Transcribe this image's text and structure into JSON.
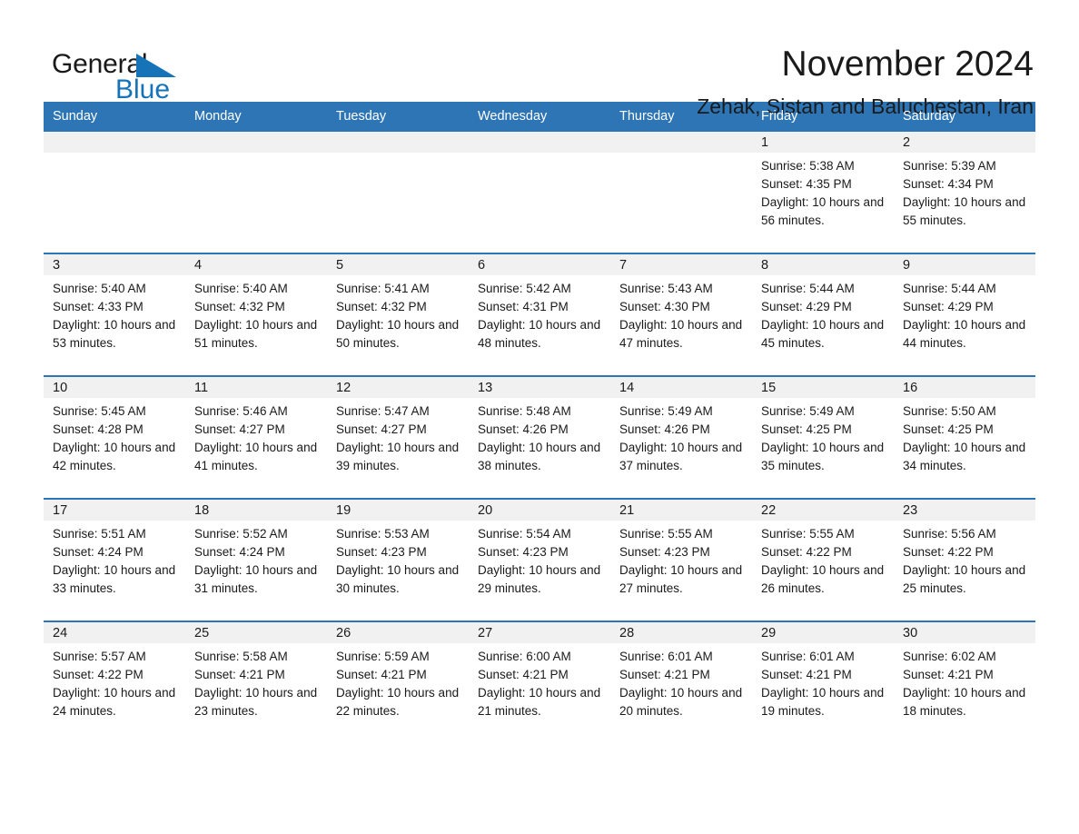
{
  "logo": {
    "word_one": "General",
    "word_two": "Blue",
    "triangle_icon": "triangle-icon",
    "brand_color": "#1773b8"
  },
  "header": {
    "month_title": "November 2024",
    "location": "Zehak, Sistan and Baluchestan, Iran"
  },
  "theme": {
    "header_blue": "#2e75b6",
    "daynum_band": "#f1f1f1",
    "text": "#1a1a1a"
  },
  "calendar": {
    "weekday_headers": [
      "Sunday",
      "Monday",
      "Tuesday",
      "Wednesday",
      "Thursday",
      "Friday",
      "Saturday"
    ],
    "weeks": [
      [
        {
          "day": "",
          "sunrise": "",
          "sunset": "",
          "daylight": "",
          "empty": true
        },
        {
          "day": "",
          "sunrise": "",
          "sunset": "",
          "daylight": "",
          "empty": true
        },
        {
          "day": "",
          "sunrise": "",
          "sunset": "",
          "daylight": "",
          "empty": true
        },
        {
          "day": "",
          "sunrise": "",
          "sunset": "",
          "daylight": "",
          "empty": true
        },
        {
          "day": "",
          "sunrise": "",
          "sunset": "",
          "daylight": "",
          "empty": true
        },
        {
          "day": "1",
          "sunrise": "Sunrise: 5:38 AM",
          "sunset": "Sunset: 4:35 PM",
          "daylight": "Daylight: 10 hours and 56 minutes.",
          "empty": false
        },
        {
          "day": "2",
          "sunrise": "Sunrise: 5:39 AM",
          "sunset": "Sunset: 4:34 PM",
          "daylight": "Daylight: 10 hours and 55 minutes.",
          "empty": false
        }
      ],
      [
        {
          "day": "3",
          "sunrise": "Sunrise: 5:40 AM",
          "sunset": "Sunset: 4:33 PM",
          "daylight": "Daylight: 10 hours and 53 minutes.",
          "empty": false
        },
        {
          "day": "4",
          "sunrise": "Sunrise: 5:40 AM",
          "sunset": "Sunset: 4:32 PM",
          "daylight": "Daylight: 10 hours and 51 minutes.",
          "empty": false
        },
        {
          "day": "5",
          "sunrise": "Sunrise: 5:41 AM",
          "sunset": "Sunset: 4:32 PM",
          "daylight": "Daylight: 10 hours and 50 minutes.",
          "empty": false
        },
        {
          "day": "6",
          "sunrise": "Sunrise: 5:42 AM",
          "sunset": "Sunset: 4:31 PM",
          "daylight": "Daylight: 10 hours and 48 minutes.",
          "empty": false
        },
        {
          "day": "7",
          "sunrise": "Sunrise: 5:43 AM",
          "sunset": "Sunset: 4:30 PM",
          "daylight": "Daylight: 10 hours and 47 minutes.",
          "empty": false
        },
        {
          "day": "8",
          "sunrise": "Sunrise: 5:44 AM",
          "sunset": "Sunset: 4:29 PM",
          "daylight": "Daylight: 10 hours and 45 minutes.",
          "empty": false
        },
        {
          "day": "9",
          "sunrise": "Sunrise: 5:44 AM",
          "sunset": "Sunset: 4:29 PM",
          "daylight": "Daylight: 10 hours and 44 minutes.",
          "empty": false
        }
      ],
      [
        {
          "day": "10",
          "sunrise": "Sunrise: 5:45 AM",
          "sunset": "Sunset: 4:28 PM",
          "daylight": "Daylight: 10 hours and 42 minutes.",
          "empty": false
        },
        {
          "day": "11",
          "sunrise": "Sunrise: 5:46 AM",
          "sunset": "Sunset: 4:27 PM",
          "daylight": "Daylight: 10 hours and 41 minutes.",
          "empty": false
        },
        {
          "day": "12",
          "sunrise": "Sunrise: 5:47 AM",
          "sunset": "Sunset: 4:27 PM",
          "daylight": "Daylight: 10 hours and 39 minutes.",
          "empty": false
        },
        {
          "day": "13",
          "sunrise": "Sunrise: 5:48 AM",
          "sunset": "Sunset: 4:26 PM",
          "daylight": "Daylight: 10 hours and 38 minutes.",
          "empty": false
        },
        {
          "day": "14",
          "sunrise": "Sunrise: 5:49 AM",
          "sunset": "Sunset: 4:26 PM",
          "daylight": "Daylight: 10 hours and 37 minutes.",
          "empty": false
        },
        {
          "day": "15",
          "sunrise": "Sunrise: 5:49 AM",
          "sunset": "Sunset: 4:25 PM",
          "daylight": "Daylight: 10 hours and 35 minutes.",
          "empty": false
        },
        {
          "day": "16",
          "sunrise": "Sunrise: 5:50 AM",
          "sunset": "Sunset: 4:25 PM",
          "daylight": "Daylight: 10 hours and 34 minutes.",
          "empty": false
        }
      ],
      [
        {
          "day": "17",
          "sunrise": "Sunrise: 5:51 AM",
          "sunset": "Sunset: 4:24 PM",
          "daylight": "Daylight: 10 hours and 33 minutes.",
          "empty": false
        },
        {
          "day": "18",
          "sunrise": "Sunrise: 5:52 AM",
          "sunset": "Sunset: 4:24 PM",
          "daylight": "Daylight: 10 hours and 31 minutes.",
          "empty": false
        },
        {
          "day": "19",
          "sunrise": "Sunrise: 5:53 AM",
          "sunset": "Sunset: 4:23 PM",
          "daylight": "Daylight: 10 hours and 30 minutes.",
          "empty": false
        },
        {
          "day": "20",
          "sunrise": "Sunrise: 5:54 AM",
          "sunset": "Sunset: 4:23 PM",
          "daylight": "Daylight: 10 hours and 29 minutes.",
          "empty": false
        },
        {
          "day": "21",
          "sunrise": "Sunrise: 5:55 AM",
          "sunset": "Sunset: 4:23 PM",
          "daylight": "Daylight: 10 hours and 27 minutes.",
          "empty": false
        },
        {
          "day": "22",
          "sunrise": "Sunrise: 5:55 AM",
          "sunset": "Sunset: 4:22 PM",
          "daylight": "Daylight: 10 hours and 26 minutes.",
          "empty": false
        },
        {
          "day": "23",
          "sunrise": "Sunrise: 5:56 AM",
          "sunset": "Sunset: 4:22 PM",
          "daylight": "Daylight: 10 hours and 25 minutes.",
          "empty": false
        }
      ],
      [
        {
          "day": "24",
          "sunrise": "Sunrise: 5:57 AM",
          "sunset": "Sunset: 4:22 PM",
          "daylight": "Daylight: 10 hours and 24 minutes.",
          "empty": false
        },
        {
          "day": "25",
          "sunrise": "Sunrise: 5:58 AM",
          "sunset": "Sunset: 4:21 PM",
          "daylight": "Daylight: 10 hours and 23 minutes.",
          "empty": false
        },
        {
          "day": "26",
          "sunrise": "Sunrise: 5:59 AM",
          "sunset": "Sunset: 4:21 PM",
          "daylight": "Daylight: 10 hours and 22 minutes.",
          "empty": false
        },
        {
          "day": "27",
          "sunrise": "Sunrise: 6:00 AM",
          "sunset": "Sunset: 4:21 PM",
          "daylight": "Daylight: 10 hours and 21 minutes.",
          "empty": false
        },
        {
          "day": "28",
          "sunrise": "Sunrise: 6:01 AM",
          "sunset": "Sunset: 4:21 PM",
          "daylight": "Daylight: 10 hours and 20 minutes.",
          "empty": false
        },
        {
          "day": "29",
          "sunrise": "Sunrise: 6:01 AM",
          "sunset": "Sunset: 4:21 PM",
          "daylight": "Daylight: 10 hours and 19 minutes.",
          "empty": false
        },
        {
          "day": "30",
          "sunrise": "Sunrise: 6:02 AM",
          "sunset": "Sunset: 4:21 PM",
          "daylight": "Daylight: 10 hours and 18 minutes.",
          "empty": false
        }
      ]
    ]
  }
}
